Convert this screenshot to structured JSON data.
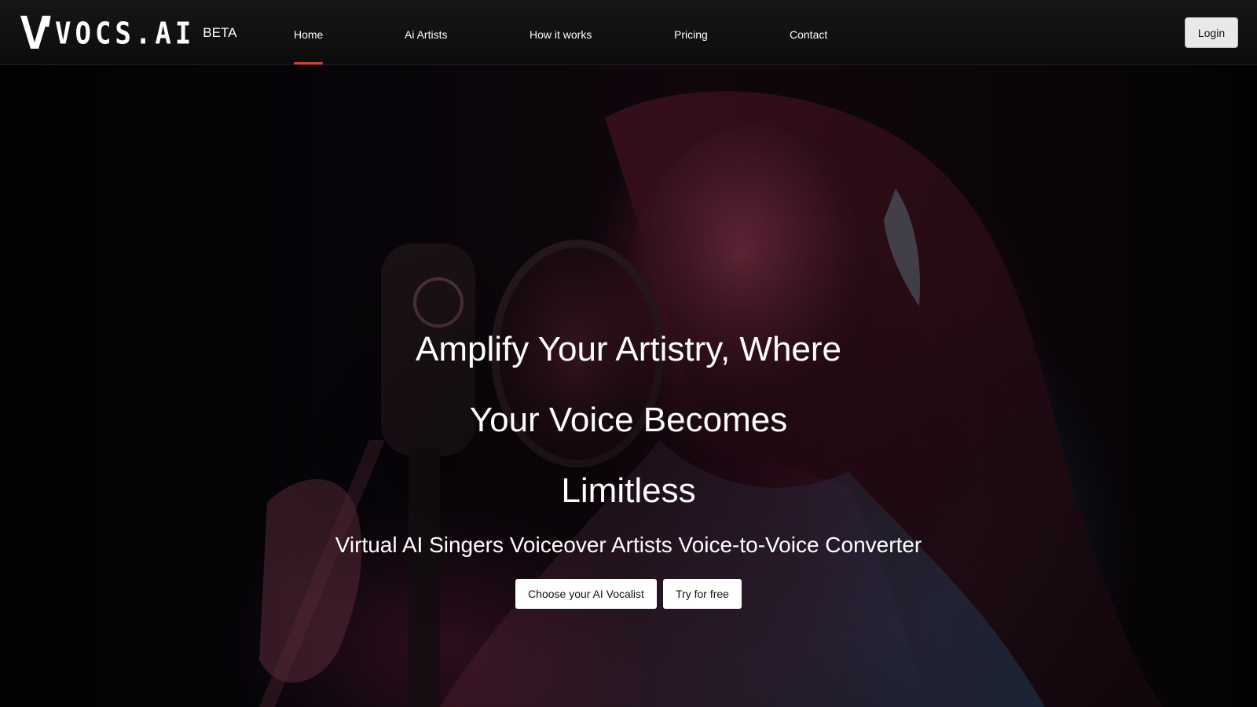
{
  "brand": {
    "name": "VOCS.AI",
    "badge": "BETA"
  },
  "nav": {
    "items": [
      {
        "label": "Home",
        "active": true
      },
      {
        "label": "Ai Artists",
        "active": false
      },
      {
        "label": "How it works",
        "active": false
      },
      {
        "label": "Pricing",
        "active": false
      },
      {
        "label": "Contact",
        "active": false
      }
    ],
    "login_label": "Login"
  },
  "hero": {
    "headline_lines": [
      "Amplify Your Artistry, Where",
      "Your Voice Becomes",
      "Limitless"
    ],
    "subheadline": "Virtual AI Singers Voiceover Artists Voice-to-Voice Converter",
    "primary_cta": "Choose your AI Vocalist",
    "secondary_cta": "Try for free",
    "background_image": "woman singing into studio microphone with pop filter"
  },
  "colors": {
    "accent": "#d83a3a",
    "navbar": "#111111",
    "button_bg": "#ffffff",
    "login_bg": "#e9e9e9"
  }
}
